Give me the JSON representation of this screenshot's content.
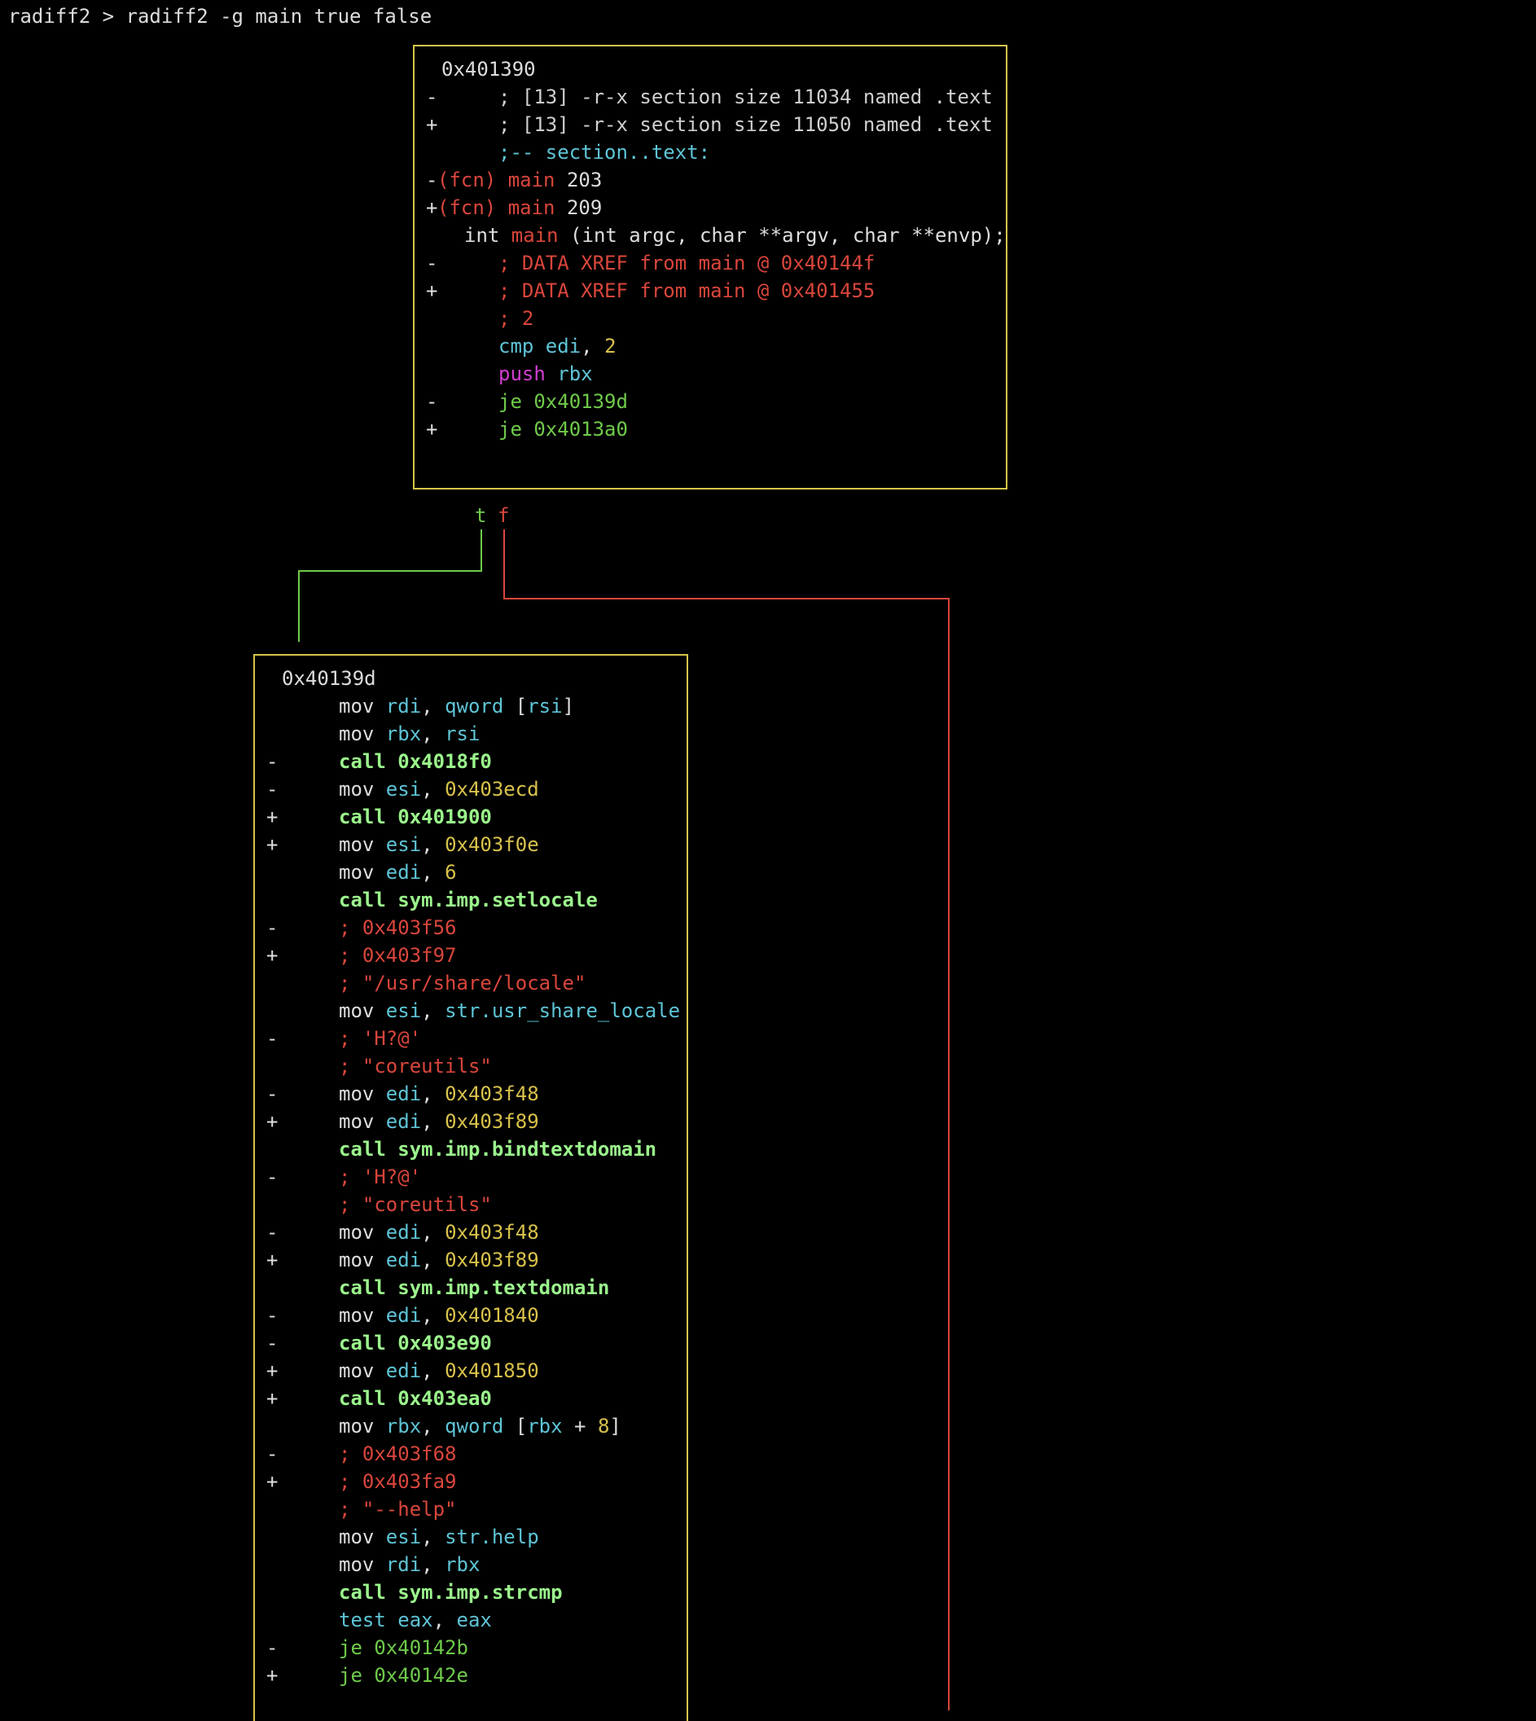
{
  "terminal": {
    "command": "radiff2 > radiff2 -g main true false"
  },
  "colors": {
    "background": "#000000",
    "border": "#d6c44a",
    "default": "#dddddd",
    "cyan": "#5ec4d6",
    "red": "#d9463c",
    "yellow": "#d9c24b",
    "green": "#6fca4a",
    "bright_green": "#9bf58c",
    "magenta": "#d23fd2"
  },
  "edges": {
    "true_label": "t",
    "false_label": "f"
  },
  "block1": {
    "lines": [
      {
        "mark": "",
        "indent": 0,
        "parts": [
          {
            "t": "0x401390",
            "c": "white"
          }
        ]
      },
      {
        "mark": "-",
        "indent": 2,
        "parts": [
          {
            "t": "; [13] -r-x section size 11034 named .text",
            "c": "gray"
          }
        ]
      },
      {
        "mark": "+",
        "indent": 2,
        "parts": [
          {
            "t": "; [13] -r-x section size 11050 named .text",
            "c": "gray"
          }
        ]
      },
      {
        "mark": "",
        "indent": 2,
        "parts": [
          {
            "t": ";-- section..text:",
            "c": "cyan"
          }
        ]
      },
      {
        "mark": "-",
        "indent": 0,
        "parts": [
          {
            "t": "(fcn) ",
            "c": "red"
          },
          {
            "t": "main",
            "c": "red"
          },
          {
            "t": " 203",
            "c": "white"
          }
        ]
      },
      {
        "mark": "+",
        "indent": 0,
        "parts": [
          {
            "t": "(fcn) ",
            "c": "red"
          },
          {
            "t": "main",
            "c": "red"
          },
          {
            "t": " 209",
            "c": "white"
          }
        ]
      },
      {
        "mark": "",
        "indent": 1,
        "parts": [
          {
            "t": "int ",
            "c": "white"
          },
          {
            "t": "main",
            "c": "red"
          },
          {
            "t": " (int argc, char **argv, char **envp);",
            "c": "white"
          }
        ]
      },
      {
        "mark": "-",
        "indent": 2,
        "parts": [
          {
            "t": "; DATA XREF from main @ 0x40144f",
            "c": "red"
          }
        ]
      },
      {
        "mark": "+",
        "indent": 2,
        "parts": [
          {
            "t": "; DATA XREF from main @ 0x401455",
            "c": "red"
          }
        ]
      },
      {
        "mark": "",
        "indent": 2,
        "parts": [
          {
            "t": "; 2",
            "c": "red"
          }
        ]
      },
      {
        "mark": "",
        "indent": 2,
        "parts": [
          {
            "t": "cmp ",
            "c": "cyan"
          },
          {
            "t": "edi",
            "c": "cyan"
          },
          {
            "t": ", ",
            "c": "white"
          },
          {
            "t": "2",
            "c": "yellow"
          }
        ]
      },
      {
        "mark": "",
        "indent": 2,
        "parts": [
          {
            "t": "push ",
            "c": "magenta"
          },
          {
            "t": "rbx",
            "c": "cyan"
          }
        ]
      },
      {
        "mark": "-",
        "indent": 2,
        "parts": [
          {
            "t": "je 0x40139d",
            "c": "green"
          }
        ]
      },
      {
        "mark": "+",
        "indent": 2,
        "parts": [
          {
            "t": "je 0x4013a0",
            "c": "green"
          }
        ]
      }
    ]
  },
  "block2": {
    "lines": [
      {
        "mark": "",
        "indent": 0,
        "parts": [
          {
            "t": "0x40139d",
            "c": "white"
          }
        ]
      },
      {
        "mark": "",
        "indent": 2,
        "parts": [
          {
            "t": "mov ",
            "c": "white"
          },
          {
            "t": "rdi",
            "c": "cyan"
          },
          {
            "t": ", ",
            "c": "white"
          },
          {
            "t": "qword ",
            "c": "cyan"
          },
          {
            "t": "[",
            "c": "white"
          },
          {
            "t": "rsi",
            "c": "cyan"
          },
          {
            "t": "]",
            "c": "white"
          }
        ]
      },
      {
        "mark": "",
        "indent": 2,
        "parts": [
          {
            "t": "mov ",
            "c": "white"
          },
          {
            "t": "rbx",
            "c": "cyan"
          },
          {
            "t": ", ",
            "c": "white"
          },
          {
            "t": "rsi",
            "c": "cyan"
          }
        ]
      },
      {
        "mark": "-",
        "indent": 2,
        "parts": [
          {
            "t": "call 0x4018f0",
            "c": "bgreen"
          }
        ]
      },
      {
        "mark": "-",
        "indent": 2,
        "parts": [
          {
            "t": "mov ",
            "c": "white"
          },
          {
            "t": "esi",
            "c": "cyan"
          },
          {
            "t": ", ",
            "c": "white"
          },
          {
            "t": "0x403ecd",
            "c": "yellow"
          }
        ]
      },
      {
        "mark": "+",
        "indent": 2,
        "parts": [
          {
            "t": "call 0x401900",
            "c": "bgreen"
          }
        ]
      },
      {
        "mark": "+",
        "indent": 2,
        "parts": [
          {
            "t": "mov ",
            "c": "white"
          },
          {
            "t": "esi",
            "c": "cyan"
          },
          {
            "t": ", ",
            "c": "white"
          },
          {
            "t": "0x403f0e",
            "c": "yellow"
          }
        ]
      },
      {
        "mark": "",
        "indent": 2,
        "parts": [
          {
            "t": "mov ",
            "c": "white"
          },
          {
            "t": "edi",
            "c": "cyan"
          },
          {
            "t": ", ",
            "c": "white"
          },
          {
            "t": "6",
            "c": "yellow"
          }
        ]
      },
      {
        "mark": "",
        "indent": 2,
        "parts": [
          {
            "t": "call sym.imp.setlocale",
            "c": "bgreen"
          }
        ]
      },
      {
        "mark": "-",
        "indent": 2,
        "parts": [
          {
            "t": "; 0x403f56",
            "c": "red"
          }
        ]
      },
      {
        "mark": "+",
        "indent": 2,
        "parts": [
          {
            "t": "; 0x403f97",
            "c": "red"
          }
        ]
      },
      {
        "mark": "",
        "indent": 2,
        "parts": [
          {
            "t": "; \"/usr/share/locale\"",
            "c": "red"
          }
        ]
      },
      {
        "mark": "",
        "indent": 2,
        "parts": [
          {
            "t": "mov ",
            "c": "white"
          },
          {
            "t": "esi",
            "c": "cyan"
          },
          {
            "t": ", ",
            "c": "white"
          },
          {
            "t": "str.usr_share_locale",
            "c": "cyan"
          }
        ]
      },
      {
        "mark": "-",
        "indent": 2,
        "parts": [
          {
            "t": "; 'H?@'",
            "c": "red"
          }
        ]
      },
      {
        "mark": "",
        "indent": 2,
        "parts": [
          {
            "t": "; \"coreutils\"",
            "c": "red"
          }
        ]
      },
      {
        "mark": "-",
        "indent": 2,
        "parts": [
          {
            "t": "mov ",
            "c": "white"
          },
          {
            "t": "edi",
            "c": "cyan"
          },
          {
            "t": ", ",
            "c": "white"
          },
          {
            "t": "0x403f48",
            "c": "yellow"
          }
        ]
      },
      {
        "mark": "+",
        "indent": 2,
        "parts": [
          {
            "t": "mov ",
            "c": "white"
          },
          {
            "t": "edi",
            "c": "cyan"
          },
          {
            "t": ", ",
            "c": "white"
          },
          {
            "t": "0x403f89",
            "c": "yellow"
          }
        ]
      },
      {
        "mark": "",
        "indent": 2,
        "parts": [
          {
            "t": "call sym.imp.bindtextdomain",
            "c": "bgreen"
          }
        ]
      },
      {
        "mark": "-",
        "indent": 2,
        "parts": [
          {
            "t": "; 'H?@'",
            "c": "red"
          }
        ]
      },
      {
        "mark": "",
        "indent": 2,
        "parts": [
          {
            "t": "; \"coreutils\"",
            "c": "red"
          }
        ]
      },
      {
        "mark": "-",
        "indent": 2,
        "parts": [
          {
            "t": "mov ",
            "c": "white"
          },
          {
            "t": "edi",
            "c": "cyan"
          },
          {
            "t": ", ",
            "c": "white"
          },
          {
            "t": "0x403f48",
            "c": "yellow"
          }
        ]
      },
      {
        "mark": "+",
        "indent": 2,
        "parts": [
          {
            "t": "mov ",
            "c": "white"
          },
          {
            "t": "edi",
            "c": "cyan"
          },
          {
            "t": ", ",
            "c": "white"
          },
          {
            "t": "0x403f89",
            "c": "yellow"
          }
        ]
      },
      {
        "mark": "",
        "indent": 2,
        "parts": [
          {
            "t": "call sym.imp.textdomain",
            "c": "bgreen"
          }
        ]
      },
      {
        "mark": "-",
        "indent": 2,
        "parts": [
          {
            "t": "mov ",
            "c": "white"
          },
          {
            "t": "edi",
            "c": "cyan"
          },
          {
            "t": ", ",
            "c": "white"
          },
          {
            "t": "0x401840",
            "c": "yellow"
          }
        ]
      },
      {
        "mark": "-",
        "indent": 2,
        "parts": [
          {
            "t": "call 0x403e90",
            "c": "bgreen"
          }
        ]
      },
      {
        "mark": "+",
        "indent": 2,
        "parts": [
          {
            "t": "mov ",
            "c": "white"
          },
          {
            "t": "edi",
            "c": "cyan"
          },
          {
            "t": ", ",
            "c": "white"
          },
          {
            "t": "0x401850",
            "c": "yellow"
          }
        ]
      },
      {
        "mark": "+",
        "indent": 2,
        "parts": [
          {
            "t": "call 0x403ea0",
            "c": "bgreen"
          }
        ]
      },
      {
        "mark": "",
        "indent": 2,
        "parts": [
          {
            "t": "mov ",
            "c": "white"
          },
          {
            "t": "rbx",
            "c": "cyan"
          },
          {
            "t": ", ",
            "c": "white"
          },
          {
            "t": "qword ",
            "c": "cyan"
          },
          {
            "t": "[",
            "c": "white"
          },
          {
            "t": "rbx",
            "c": "cyan"
          },
          {
            "t": " + ",
            "c": "white"
          },
          {
            "t": "8",
            "c": "yellow"
          },
          {
            "t": "]",
            "c": "white"
          }
        ]
      },
      {
        "mark": "-",
        "indent": 2,
        "parts": [
          {
            "t": "; 0x403f68",
            "c": "red"
          }
        ]
      },
      {
        "mark": "+",
        "indent": 2,
        "parts": [
          {
            "t": "; 0x403fa9",
            "c": "red"
          }
        ]
      },
      {
        "mark": "",
        "indent": 2,
        "parts": [
          {
            "t": "; \"--help\"",
            "c": "red"
          }
        ]
      },
      {
        "mark": "",
        "indent": 2,
        "parts": [
          {
            "t": "mov ",
            "c": "white"
          },
          {
            "t": "esi",
            "c": "cyan"
          },
          {
            "t": ", ",
            "c": "white"
          },
          {
            "t": "str.help",
            "c": "cyan"
          }
        ]
      },
      {
        "mark": "",
        "indent": 2,
        "parts": [
          {
            "t": "mov ",
            "c": "white"
          },
          {
            "t": "rdi",
            "c": "cyan"
          },
          {
            "t": ", ",
            "c": "white"
          },
          {
            "t": "rbx",
            "c": "cyan"
          }
        ]
      },
      {
        "mark": "",
        "indent": 2,
        "parts": [
          {
            "t": "call sym.imp.strcmp",
            "c": "bgreen"
          }
        ]
      },
      {
        "mark": "",
        "indent": 2,
        "parts": [
          {
            "t": "test ",
            "c": "cyan"
          },
          {
            "t": "eax",
            "c": "cyan"
          },
          {
            "t": ", ",
            "c": "white"
          },
          {
            "t": "eax",
            "c": "cyan"
          }
        ]
      },
      {
        "mark": "-",
        "indent": 2,
        "parts": [
          {
            "t": "je 0x40142b",
            "c": "green"
          }
        ]
      },
      {
        "mark": "+",
        "indent": 2,
        "parts": [
          {
            "t": "je 0x40142e",
            "c": "green"
          }
        ]
      }
    ]
  }
}
